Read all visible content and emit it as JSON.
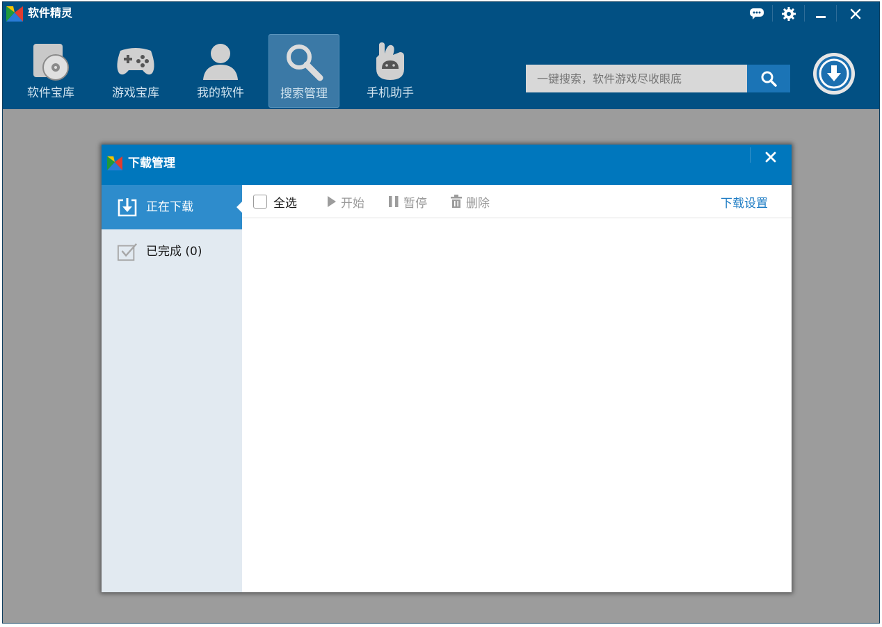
{
  "app": {
    "title": "软件精灵"
  },
  "nav": {
    "items": [
      {
        "label": "软件宝库",
        "icon": "software-disc-icon"
      },
      {
        "label": "游戏宝库",
        "icon": "gamepad-icon"
      },
      {
        "label": "我的软件",
        "icon": "user-icon"
      },
      {
        "label": "搜索管理",
        "icon": "search-magnifier-icon",
        "active": true
      },
      {
        "label": "手机助手",
        "icon": "android-hand-icon"
      }
    ]
  },
  "search": {
    "placeholder": "一键搜索，软件游戏尽收眼底"
  },
  "window_controls": [
    "feedback-icon",
    "settings-gear-icon",
    "minimize-icon",
    "close-icon"
  ],
  "dialog": {
    "title": "下载管理",
    "sidebar": {
      "items": [
        {
          "label": "正在下载",
          "icon": "download-tray-icon",
          "active": true
        },
        {
          "label": "已完成 (0)",
          "icon": "check-box-icon",
          "active": false
        }
      ]
    },
    "toolbar": {
      "select_all": "全选",
      "start": "开始",
      "pause": "暂停",
      "delete": "删除",
      "settings": "下载设置"
    }
  },
  "colors": {
    "top_bar": "#025083",
    "dialog_header": "#0077bd",
    "active_side": "#2e8ccc",
    "link_blue": "#1e7cc4",
    "disabled_text": "#999999"
  }
}
